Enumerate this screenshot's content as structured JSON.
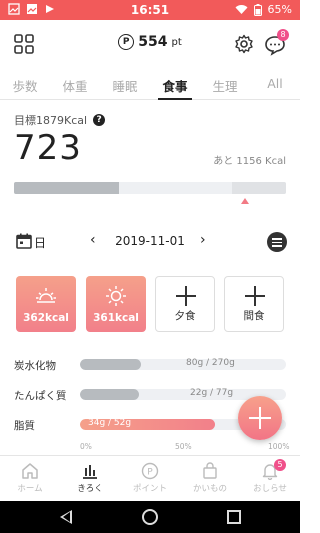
{
  "status_bar": {
    "time": "16:51",
    "battery": "65%"
  },
  "header": {
    "points_value": "554",
    "points_unit": "pt",
    "points_icon": "P",
    "chat_badge": "8"
  },
  "tabs": [
    {
      "label": "歩数"
    },
    {
      "label": "体重"
    },
    {
      "label": "睡眠"
    },
    {
      "label": "食事",
      "active": true
    },
    {
      "label": "生理"
    },
    {
      "label": "All"
    }
  ],
  "calories": {
    "target_label": "目標1879Kcal",
    "help_icon": "?",
    "value": "723",
    "remaining_label": "あと 1156 Kcal",
    "progress": 0.385,
    "target_zone_start": 0.8,
    "target_zone_end": 1.0
  },
  "date_nav": {
    "day_label": "日",
    "date": "2019-11-01",
    "prev": "‹",
    "next": "›"
  },
  "meals": [
    {
      "label": "362kcal",
      "filled": true,
      "icon": "sunrise-icon"
    },
    {
      "label": "361kcal",
      "filled": true,
      "icon": "sun-icon"
    },
    {
      "label": "夕食",
      "filled": false,
      "icon": "plus-icon"
    },
    {
      "label": "間食",
      "filled": false,
      "icon": "plus-icon"
    }
  ],
  "nutrients": [
    {
      "label": "炭水化物",
      "text": "80g / 270g",
      "ratio": 0.296
    },
    {
      "label": "たんぱく質",
      "text": "22g / 77g",
      "ratio": 0.286
    },
    {
      "label": "脂質",
      "text": "34g / 52g",
      "ratio": 0.654
    }
  ],
  "scale": {
    "start": "0%",
    "mid": "50%",
    "end": "100%"
  },
  "bottom_nav": [
    {
      "label": "ホーム",
      "icon": "home-icon"
    },
    {
      "label": "きろく",
      "icon": "chart-icon",
      "active": true
    },
    {
      "label": "ポイント",
      "icon": "point-icon"
    },
    {
      "label": "かいもの",
      "icon": "shopping-bag-icon"
    },
    {
      "label": "おしらせ",
      "icon": "bell-icon",
      "badge": "5"
    }
  ],
  "colors": {
    "brand": "#f25a5a",
    "accent_gradient_start": "#f5a08a",
    "accent_gradient_end": "#f2808a",
    "badge": "#f0508a"
  }
}
